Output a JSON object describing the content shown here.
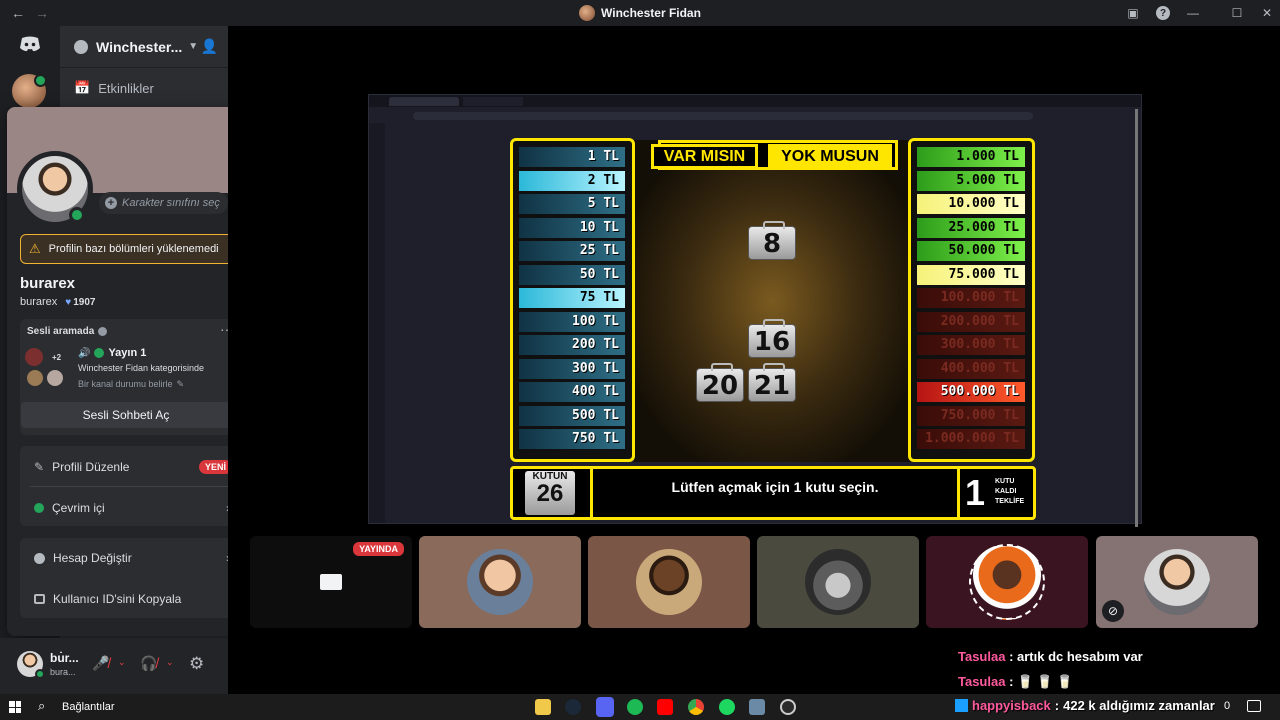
{
  "window": {
    "title": "Winchester Fidan"
  },
  "server": {
    "name": "Winchester..."
  },
  "channels": {
    "events": "Etkinlikler"
  },
  "profile": {
    "class_placeholder": "Karakter sınıfını seç",
    "warning": "Profilin bazı bölümleri yüklenemedi",
    "display_name": "burarex",
    "username": "burarex",
    "badge_count": "1907",
    "voice_header": "Sesli aramada",
    "voice_more": "+2",
    "voice_channel": "Yayın 1",
    "voice_category": "Winchester Fidan kategorisinde",
    "voice_status_hint": "Bir kanal durumu belirle",
    "open_chat_button": "Sesli Sohbeti Aç",
    "edit_profile": "Profili Düzenle",
    "new_badge": "YENİ",
    "status": "Çevrim içi",
    "switch_account": "Hesap Değiştir",
    "copy_id": "Kullanıcı ID'sini Kopyala"
  },
  "user_panel": {
    "name": "bu̇r...",
    "sub": "bura..."
  },
  "game": {
    "title_left": "VAR MISIN",
    "title_right": "YOK MUSUN",
    "left_prizes": [
      {
        "label": "1 TL",
        "active": false
      },
      {
        "label": "2 TL",
        "active": true
      },
      {
        "label": "5 TL",
        "active": false
      },
      {
        "label": "10 TL",
        "active": false
      },
      {
        "label": "25 TL",
        "active": false
      },
      {
        "label": "50 TL",
        "active": false
      },
      {
        "label": "75 TL",
        "active": true
      },
      {
        "label": "100 TL",
        "active": false
      },
      {
        "label": "200 TL",
        "active": false
      },
      {
        "label": "300 TL",
        "active": false
      },
      {
        "label": "400 TL",
        "active": false
      },
      {
        "label": "500 TL",
        "active": false
      },
      {
        "label": "750 TL",
        "active": false
      }
    ],
    "right_prizes": [
      {
        "label": "1.000 TL",
        "state": "green"
      },
      {
        "label": "5.000 TL",
        "state": "green"
      },
      {
        "label": "10.000 TL",
        "state": "yellow"
      },
      {
        "label": "25.000 TL",
        "state": "green"
      },
      {
        "label": "50.000 TL",
        "state": "green"
      },
      {
        "label": "75.000 TL",
        "state": "yellow"
      },
      {
        "label": "100.000 TL",
        "state": "dark"
      },
      {
        "label": "200.000 TL",
        "state": "dark"
      },
      {
        "label": "300.000 TL",
        "state": "dark"
      },
      {
        "label": "400.000 TL",
        "state": "dark"
      },
      {
        "label": "500.000 TL",
        "state": "red"
      },
      {
        "label": "750.000 TL",
        "state": "dark"
      },
      {
        "label": "1.000.000 TL",
        "state": "dark"
      }
    ],
    "cases": [
      "8",
      "16",
      "20",
      "21"
    ],
    "your_case_label": "KUTUN",
    "your_case_number": "26",
    "instruction": "Lütfen açmak için 1 kutu seçin.",
    "remaining_number": "1",
    "remaining_lines": [
      "KUTU",
      "KALDI",
      "TEKLİFE"
    ]
  },
  "stream": {
    "live_badge": "YAYINDA"
  },
  "chat": [
    {
      "user": "Tasulaa",
      "text": "artık dc hesabım var"
    },
    {
      "user": "Tasulaa",
      "text": "🥛 🥛 🥛"
    },
    {
      "user": "happyisback",
      "text": "422 k aldığımız zamanlar"
    }
  ],
  "taskbar": {
    "search_label": "Bağlantılar",
    "clock_fragment": "0"
  }
}
